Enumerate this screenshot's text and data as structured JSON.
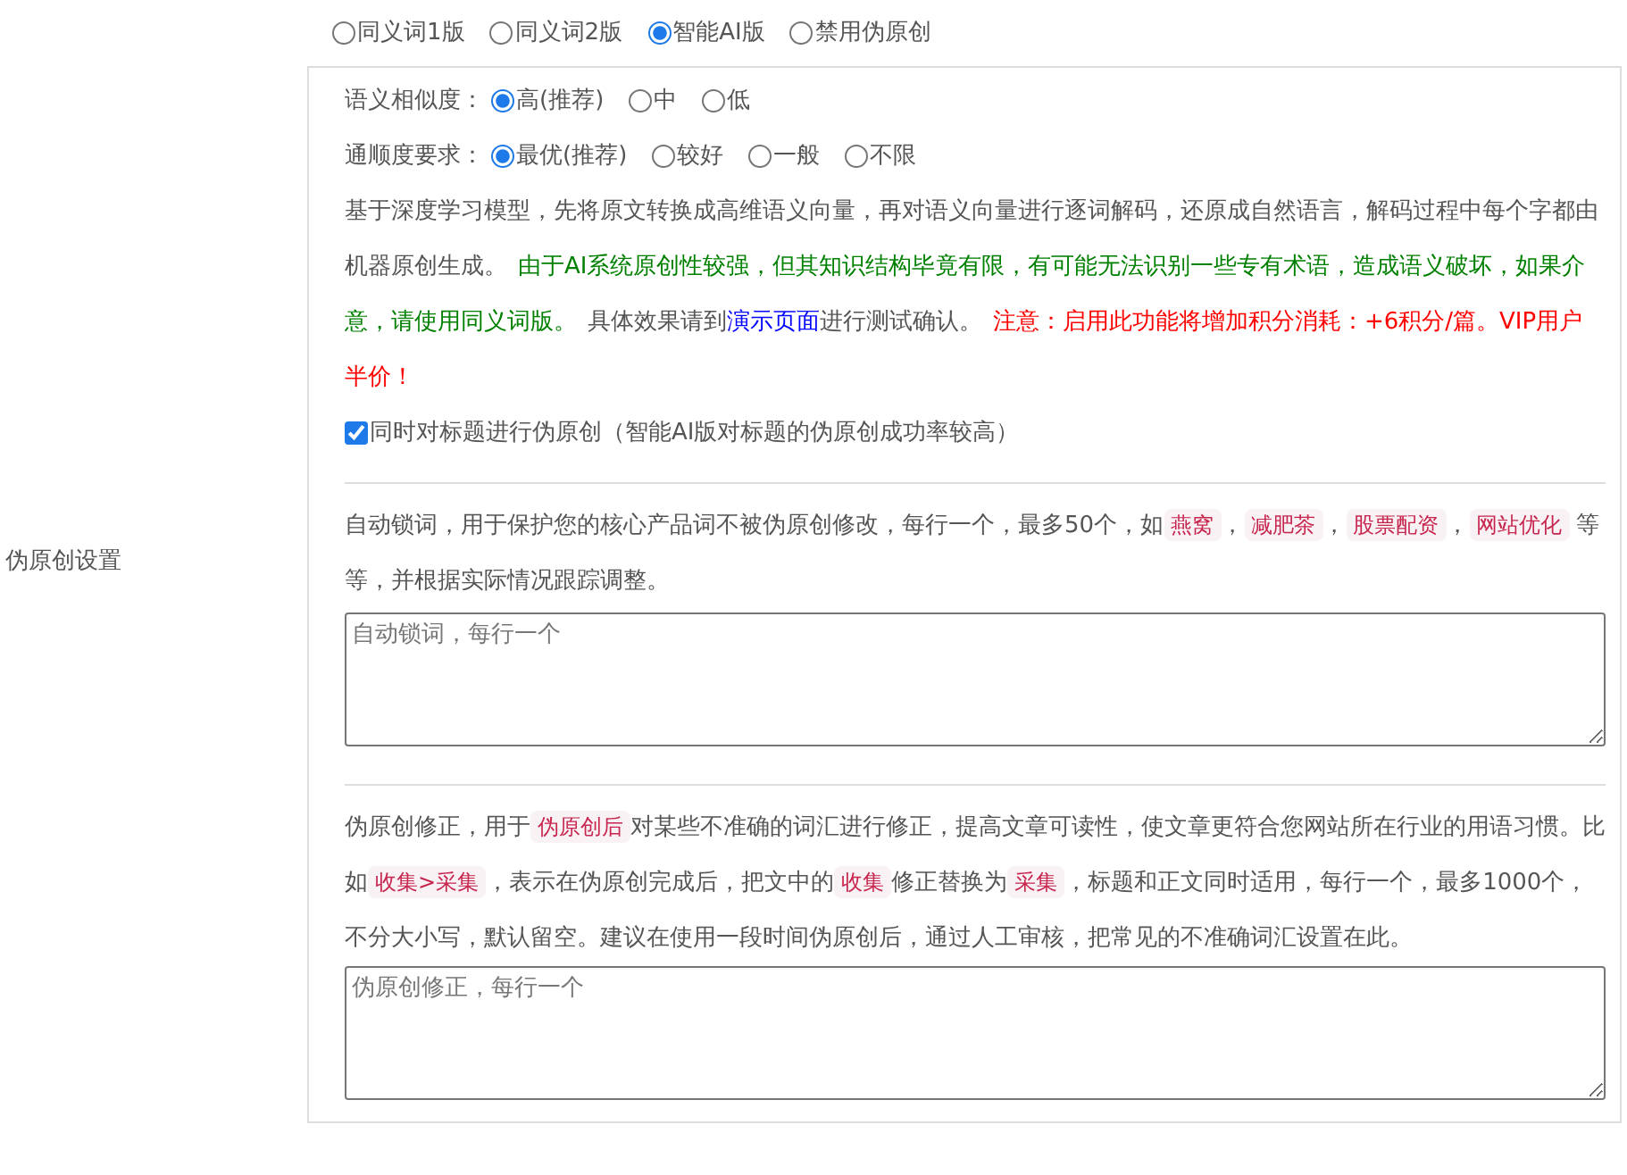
{
  "label": "伪原创设置",
  "modes": [
    {
      "label": "同义词1版",
      "selected": false
    },
    {
      "label": "同义词2版",
      "selected": false
    },
    {
      "label": "智能AI版",
      "selected": true
    },
    {
      "label": "禁用伪原创",
      "selected": false
    }
  ],
  "ai_panel": {
    "similarity": {
      "label": "语义相似度：",
      "options": [
        {
          "label": "高(推荐)",
          "selected": true
        },
        {
          "label": "中",
          "selected": false
        },
        {
          "label": "低",
          "selected": false
        }
      ]
    },
    "fluency": {
      "label": "通顺度要求：",
      "options": [
        {
          "label": "最优(推荐)",
          "selected": true
        },
        {
          "label": "较好",
          "selected": false
        },
        {
          "label": "一般",
          "selected": false
        },
        {
          "label": "不限",
          "selected": false
        }
      ]
    },
    "description": [
      {
        "kind": "plain",
        "text": "基于深度学习模型，先将原文转换成高维语义向量，再对语义向量进行逐词解码，还原成自然语言，解码过程中每个字都由机器原创生成。"
      },
      {
        "kind": "notice",
        "text": "由于AI系统原创性较强，但其知识结构毕竟有限，有可能无法识别一些专有术语，造成语义破坏，如果介意，请使用同义词版。"
      },
      {
        "kind": "plain",
        "text": "具体效果请到"
      },
      {
        "kind": "link",
        "text": "演示页面"
      },
      {
        "kind": "plain",
        "text": "进行测试确认。"
      },
      {
        "kind": "warning",
        "text": "注意：启用此功能将增加积分消耗：+6积分/篇。VIP用户半价！"
      }
    ],
    "title_option": {
      "label": "同时对标题进行伪原创（智能AI版对标题的伪原创成功率较高）",
      "checked": true
    }
  },
  "lock_words": {
    "description": [
      {
        "kind": "plain",
        "text": "自动锁词，用于保护您的核心产品词不被伪原创修改，每行一个，最多50个，如"
      },
      {
        "kind": "code",
        "text": "燕窝"
      },
      {
        "kind": "plain",
        "text": "，"
      },
      {
        "kind": "code",
        "text": "减肥茶"
      },
      {
        "kind": "plain",
        "text": "，"
      },
      {
        "kind": "code",
        "text": "股票配资"
      },
      {
        "kind": "plain",
        "text": "，"
      },
      {
        "kind": "code",
        "text": "网站优化"
      },
      {
        "kind": "plain",
        "text": " 等等，并根据实际情况跟踪调整。"
      }
    ],
    "placeholder": "自动锁词，每行一个"
  },
  "corrections": {
    "description": [
      {
        "kind": "plain",
        "text": "伪原创修正，用于"
      },
      {
        "kind": "code",
        "text": "伪原创后"
      },
      {
        "kind": "plain",
        "text": "对某些不准确的词汇进行修正，提高文章可读性，使文章更符合您网站所在行业的用语习惯。比如"
      },
      {
        "kind": "code",
        "text": "收集>采集"
      },
      {
        "kind": "plain",
        "text": "，表示在伪原创完成后，把文中的"
      },
      {
        "kind": "code",
        "text": "收集"
      },
      {
        "kind": "plain",
        "text": "修正替换为"
      },
      {
        "kind": "code",
        "text": "采集"
      },
      {
        "kind": "plain",
        "text": "，标题和正文同时适用，每行一个，最多1000个，不分大小写，默认留空。建议在使用一段时间伪原创后，通过人工审核，把常见的不准确词汇设置在此。"
      }
    ],
    "placeholder": "伪原创修正，每行一个"
  }
}
